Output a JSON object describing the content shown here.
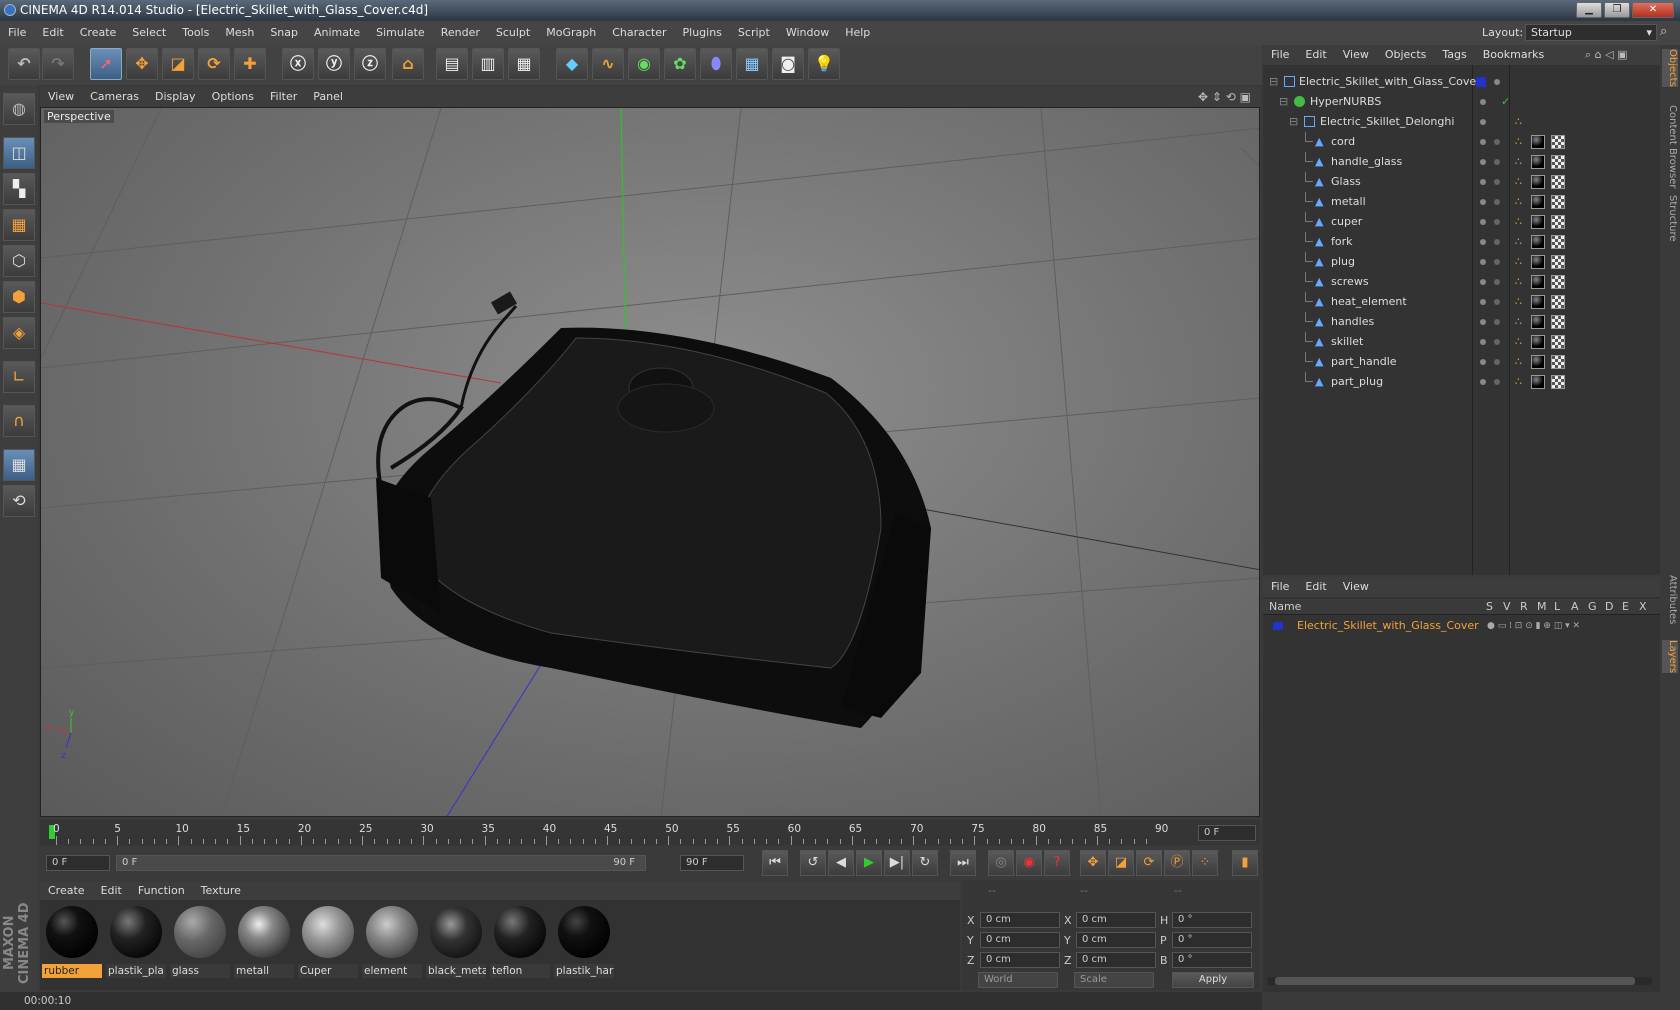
{
  "window": {
    "title": "CINEMA 4D R14.014 Studio - [Electric_Skillet_with_Glass_Cover.c4d]"
  },
  "menubar": [
    "File",
    "Edit",
    "Create",
    "Select",
    "Tools",
    "Mesh",
    "Snap",
    "Animate",
    "Simulate",
    "Render",
    "Sculpt",
    "MoGraph",
    "Character",
    "Plugins",
    "Script",
    "Window",
    "Help"
  ],
  "layout": {
    "label": "Layout:",
    "value": "Startup"
  },
  "viewport": {
    "menu": [
      "View",
      "Cameras",
      "Display",
      "Options",
      "Filter",
      "Panel"
    ],
    "label": "Perspective"
  },
  "timeline": {
    "ticks": [
      "0",
      "5",
      "10",
      "15",
      "20",
      "25",
      "30",
      "35",
      "40",
      "45",
      "50",
      "55",
      "60",
      "65",
      "70",
      "75",
      "80",
      "85",
      "90"
    ],
    "current_frame": "0 F",
    "start_field": "0 F",
    "range_start": "0 F",
    "range_end": "90 F",
    "end_field": "90 F"
  },
  "materials": {
    "menu": [
      "Create",
      "Edit",
      "Function",
      "Texture"
    ],
    "items": [
      "rubber",
      "plastik_pla",
      "glass",
      "metall",
      "Cuper",
      "element",
      "black_meta",
      "teflon",
      "plastik_har"
    ]
  },
  "coords": {
    "headers": [
      "--",
      "--",
      "--"
    ],
    "rows": [
      {
        "a": "X",
        "av": "0 cm",
        "b": "X",
        "bv": "0 cm",
        "c": "H",
        "cv": "0 °"
      },
      {
        "a": "Y",
        "av": "0 cm",
        "b": "Y",
        "bv": "0 cm",
        "c": "P",
        "cv": "0 °"
      },
      {
        "a": "Z",
        "av": "0 cm",
        "b": "Z",
        "bv": "0 cm",
        "c": "B",
        "cv": "0 °"
      }
    ],
    "world": "World",
    "scale": "Scale",
    "apply": "Apply"
  },
  "status": {
    "time": "00:00:10"
  },
  "logo": {
    "text": "MAXON CINEMA 4D"
  },
  "objects": {
    "menu": [
      "File",
      "Edit",
      "View",
      "Objects",
      "Tags",
      "Bookmarks"
    ],
    "root": "Electric_Skillet_with_Glass_Cover",
    "nurbs": "HyperNURBS",
    "group": "Electric_Skillet_Delonghi",
    "children": [
      "cord",
      "handle_glass",
      "Glass",
      "metall",
      "cuper",
      "fork",
      "plug",
      "screws",
      "heat_element",
      "handles",
      "skillet",
      "part_handle",
      "part_plug"
    ]
  },
  "layers": {
    "menu": [
      "File",
      "Edit",
      "View"
    ],
    "cols": [
      "Name",
      "S",
      "V",
      "R",
      "M",
      "L",
      "A",
      "G",
      "D",
      "E",
      "X"
    ],
    "row": "Electric_Skillet_with_Glass_Cover"
  },
  "side_tabs": [
    "Objects",
    "Content Browser",
    "Structure",
    "Attributes",
    "Layers"
  ],
  "colors": {
    "accent": "#f3a23a",
    "layer_blue": "#2233cc",
    "selection": "#4d7fb8"
  }
}
